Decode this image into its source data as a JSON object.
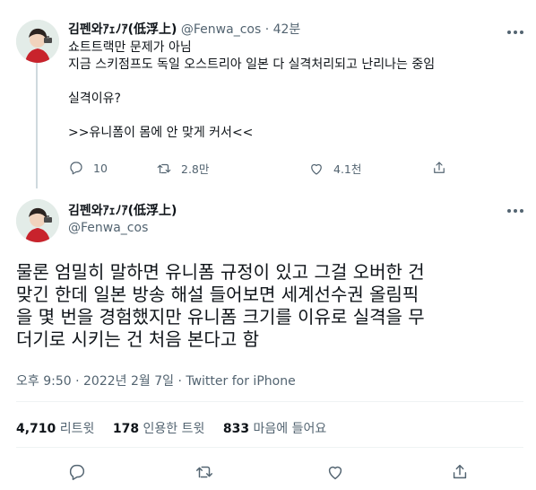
{
  "colors": {
    "text": "#0f1419",
    "secondary": "#536471",
    "divider": "#eff3f4",
    "thread_line": "#cfd9de"
  },
  "reply_tweet": {
    "display_name": "김펜와ｱｪﾉｱ(低浮上)",
    "handle": "@Fenwa_cos",
    "separator": "·",
    "time": "42분",
    "lines": [
      "쇼트트랙만 문제가 아님",
      "지금 스키점프도 독일 오스트리아 일본 다 실격처리되고 난리나는 중임",
      "",
      "실격이유?",
      "",
      ">>유니폼이 몸에 안 맞게 커서<<"
    ],
    "actions": {
      "reply_icon": "reply-icon",
      "reply_count": "10",
      "retweet_icon": "retweet-icon",
      "retweet_count": "2.8만",
      "like_icon": "heart-icon",
      "like_count": "4.1천",
      "share_icon": "share-icon"
    },
    "more_icon": "more-icon"
  },
  "main_tweet": {
    "display_name": "김펜와ｱｪﾉｱ(低浮上)",
    "handle": "@Fenwa_cos",
    "text_lines": [
      "물론 엄밀히 말하면 유니폼 규정이 있고 그걸 오버한 건",
      "맞긴 한데 일본 방송 해설 들어보면 세계선수권 올림픽",
      "을 몇 번을 경험했지만 유니폼 크기를 이유로 실격을 무",
      "더기로 시키는 건 처음 본다고 함"
    ],
    "meta": {
      "time": "오후 9:50",
      "separator": "·",
      "date": "2022년 2월 7일",
      "source": "Twitter for iPhone"
    },
    "stats": {
      "retweets_count": "4,710",
      "retweets_label": "리트윗",
      "quotes_count": "178",
      "quotes_label": "인용한 트윗",
      "likes_count": "833",
      "likes_label": "마음에 들어요"
    },
    "more_icon": "more-icon"
  }
}
